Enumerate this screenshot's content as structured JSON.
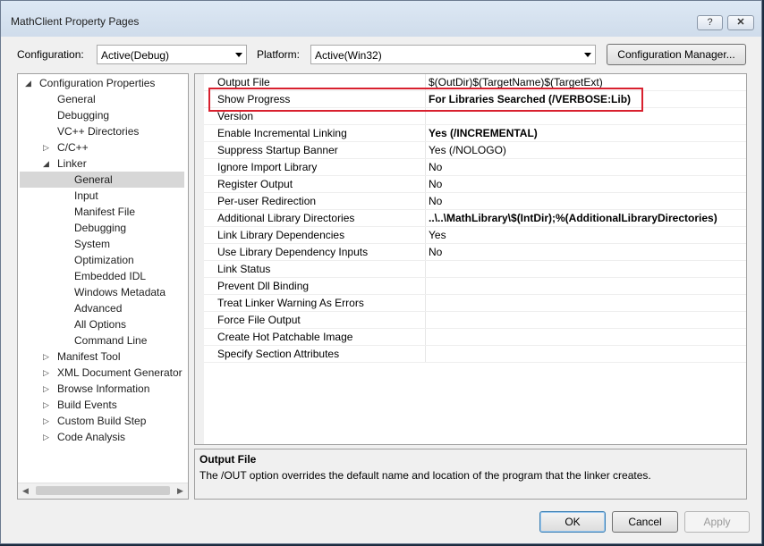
{
  "window": {
    "title": "MathClient Property Pages",
    "help_glyph": "?",
    "close_glyph": "✕"
  },
  "toolbar": {
    "configuration_label": "Configuration:",
    "configuration_value": "Active(Debug)",
    "platform_label": "Platform:",
    "platform_value": "Active(Win32)",
    "config_manager_label": "Configuration Manager..."
  },
  "tree": {
    "items": [
      {
        "label": "Configuration Properties",
        "expander": "◢"
      },
      {
        "label": "General"
      },
      {
        "label": "Debugging"
      },
      {
        "label": "VC++ Directories"
      },
      {
        "label": "C/C++",
        "expander": "▷"
      },
      {
        "label": "Linker",
        "expander": "◢"
      },
      {
        "label": "General",
        "selected": true
      },
      {
        "label": "Input"
      },
      {
        "label": "Manifest File"
      },
      {
        "label": "Debugging"
      },
      {
        "label": "System"
      },
      {
        "label": "Optimization"
      },
      {
        "label": "Embedded IDL"
      },
      {
        "label": "Windows Metadata"
      },
      {
        "label": "Advanced"
      },
      {
        "label": "All Options"
      },
      {
        "label": "Command Line"
      },
      {
        "label": "Manifest Tool",
        "expander": "▷"
      },
      {
        "label": "XML Document Generator",
        "expander": "▷"
      },
      {
        "label": "Browse Information",
        "expander": "▷"
      },
      {
        "label": "Build Events",
        "expander": "▷"
      },
      {
        "label": "Custom Build Step",
        "expander": "▷"
      },
      {
        "label": "Code Analysis",
        "expander": "▷"
      }
    ],
    "scroll_left_glyph": "◀",
    "scroll_right_glyph": "▶"
  },
  "properties": [
    {
      "name": "Output File",
      "value": "$(OutDir)$(TargetName)$(TargetExt)",
      "bold": false
    },
    {
      "name": "Show Progress",
      "value": "For Libraries Searched (/VERBOSE:Lib)",
      "bold": true
    },
    {
      "name": "Version",
      "value": "",
      "bold": false
    },
    {
      "name": "Enable Incremental Linking",
      "value": "Yes (/INCREMENTAL)",
      "bold": true
    },
    {
      "name": "Suppress Startup Banner",
      "value": "Yes (/NOLOGO)",
      "bold": false
    },
    {
      "name": "Ignore Import Library",
      "value": "No",
      "bold": false
    },
    {
      "name": "Register Output",
      "value": "No",
      "bold": false
    },
    {
      "name": "Per-user Redirection",
      "value": "No",
      "bold": false
    },
    {
      "name": "Additional Library Directories",
      "value": "..\\..\\MathLibrary\\$(IntDir);%(AdditionalLibraryDirectories)",
      "bold": true
    },
    {
      "name": "Link Library Dependencies",
      "value": "Yes",
      "bold": false
    },
    {
      "name": "Use Library Dependency Inputs",
      "value": "No",
      "bold": false
    },
    {
      "name": "Link Status",
      "value": "",
      "bold": false
    },
    {
      "name": "Prevent Dll Binding",
      "value": "",
      "bold": false
    },
    {
      "name": "Treat Linker Warning As Errors",
      "value": "",
      "bold": false
    },
    {
      "name": "Force File Output",
      "value": "",
      "bold": false
    },
    {
      "name": "Create Hot Patchable Image",
      "value": "",
      "bold": false
    },
    {
      "name": "Specify Section Attributes",
      "value": "",
      "bold": false
    }
  ],
  "description": {
    "title": "Output File",
    "text": "The /OUT option overrides the default name and location of the program that the linker creates."
  },
  "buttons": {
    "ok": "OK",
    "cancel": "Cancel",
    "apply": "Apply"
  },
  "colors": {
    "highlight_border": "#d8202e",
    "tree_selected": "#d7d7d7"
  }
}
